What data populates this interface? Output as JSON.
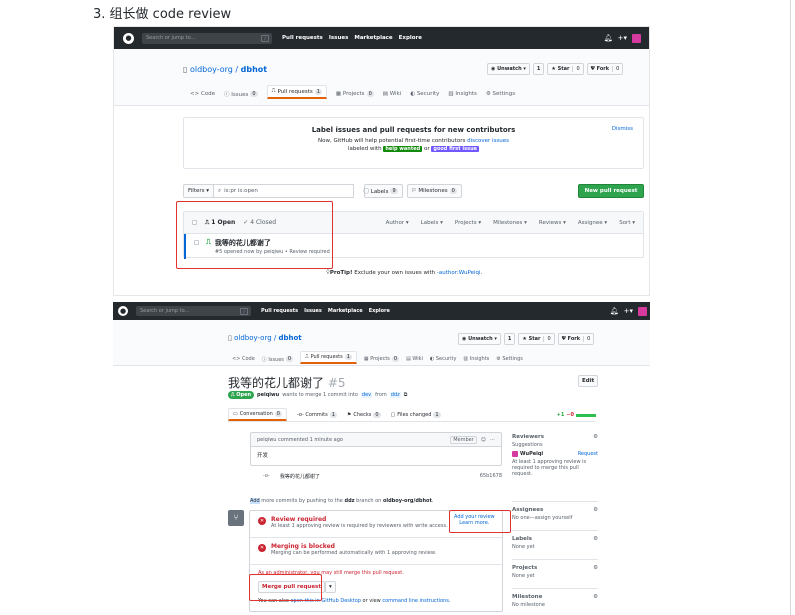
{
  "heading": "3. 组长做 code review",
  "nav": {
    "search_placeholder": "Search or jump to...",
    "slash": "/",
    "links": [
      "Pull requests",
      "Issues",
      "Marketplace",
      "Explore"
    ],
    "plus": "+▾"
  },
  "repo": {
    "owner": "oldboy-org",
    "sep": " / ",
    "name": "dbhot",
    "unwatch": "◉ Unwatch ▾",
    "unwatch_count": "1",
    "star": "★ Star",
    "star_count": "0",
    "fork": "Ψ Fork",
    "fork_count": "0"
  },
  "tabs": [
    {
      "label": "<> Code",
      "count": ""
    },
    {
      "label": "ⓘ Issues",
      "count": "0"
    },
    {
      "label": "Pull requests",
      "count": "1"
    },
    {
      "label": "▦ Projects",
      "count": "0"
    },
    {
      "label": "▤ Wiki",
      "count": ""
    },
    {
      "label": "◐ Security",
      "count": ""
    },
    {
      "label": "▥ Insights",
      "count": ""
    },
    {
      "label": "⚙ Settings",
      "count": ""
    }
  ],
  "banner": {
    "title": "Label issues and pull requests for new contributors",
    "line1": "Now, GitHub will help potential first-time contributors",
    "line1_link": "discover issues",
    "line2_pre": "labeled with",
    "label_help": "help wanted",
    "label_or": "or",
    "label_good": "good first issue",
    "dismiss": "Dismiss",
    "help_color": "#128a0c",
    "good_color": "#7057ff"
  },
  "filters": {
    "filters_btn": "Filters ▾",
    "query": "is:pr is:open",
    "labels": "⃝ Labels",
    "labels_count": "9",
    "milestones": "⚐ Milestones",
    "milestones_count": "0",
    "new_pr": "New pull request"
  },
  "prlist": {
    "open": "1 Open",
    "closed": "✓ 4 Closed",
    "columns": [
      "Author ▾",
      "Labels ▾",
      "Projects ▾",
      "Milestones ▾",
      "Reviews ▾",
      "Assignee ▾",
      "Sort ▾"
    ],
    "pr_title": "我等的花儿都谢了",
    "pr_meta": "#5 opened now by peiqiwu • Review required"
  },
  "protip": {
    "lead": "ProTip!",
    "text": " Exclude your own issues with ",
    "link": "-author:WuPeiqi",
    "end": "."
  },
  "pr": {
    "title": "我等的花儿都谢了",
    "number": "#5",
    "edit": "Edit",
    "state": "Open",
    "author": "peiqiwu",
    "meta_text": "wants to merge 1 commit into",
    "base": "dev",
    "from": "from",
    "head": "ddz",
    "tabs": [
      {
        "label": "Conversation",
        "count": "0"
      },
      {
        "label": "-o- Commits",
        "count": "1"
      },
      {
        "label": "Checks",
        "count": "0"
      },
      {
        "label": "Files changed",
        "count": "1"
      }
    ],
    "diff_add": "+1",
    "diff_del": "−0",
    "comment_head": "peiqiwu commented 1 minute ago",
    "member": "Member",
    "comment_body": "开发",
    "commit_msg": "我等的花儿都谢了",
    "commit_sha": "65b1678",
    "push_hint_add": "Add",
    "push_hint_pre": " more commits by pushing to the ",
    "push_branch": "ddz",
    "push_mid": " branch on ",
    "push_repo": "oldboy-org/dbhot",
    "push_end": ".",
    "review_title": "Review required",
    "review_text": "At least 1 approving review is required by reviewers with write access.",
    "learn_more": "Learn more.",
    "add_review": "Add your review",
    "blocked_title": "Merging is blocked",
    "blocked_text": "Merging can be performed automatically with 1 approving review.",
    "admin_text": "As an administrator, you may still merge this pull request.",
    "merge_btn": "Merge pull request",
    "merge_caret": "▾",
    "cli_pre": "You can also ",
    "cli_link1": "open this in GitHub Desktop",
    "cli_mid": " or view ",
    "cli_link2": "command line instructions",
    "cli_end": "."
  },
  "sidebar": {
    "reviewers": "Reviewers",
    "suggestions": "Suggestions",
    "reviewer_name": "WuPeiqi",
    "request": "Request",
    "reviewer_note": "At least 1 approving review is required to merge this pull request.",
    "assignees": "Assignees",
    "assignees_val": "No one—assign yourself",
    "labels": "Labels",
    "labels_val": "None yet",
    "projects": "Projects",
    "projects_val": "None yet",
    "milestone": "Milestone",
    "milestone_val": "No milestone"
  },
  "colors": {
    "accent_red": "#e0332f",
    "green": "#2ea44f",
    "link": "#0366d6",
    "dark": "#24292e"
  }
}
